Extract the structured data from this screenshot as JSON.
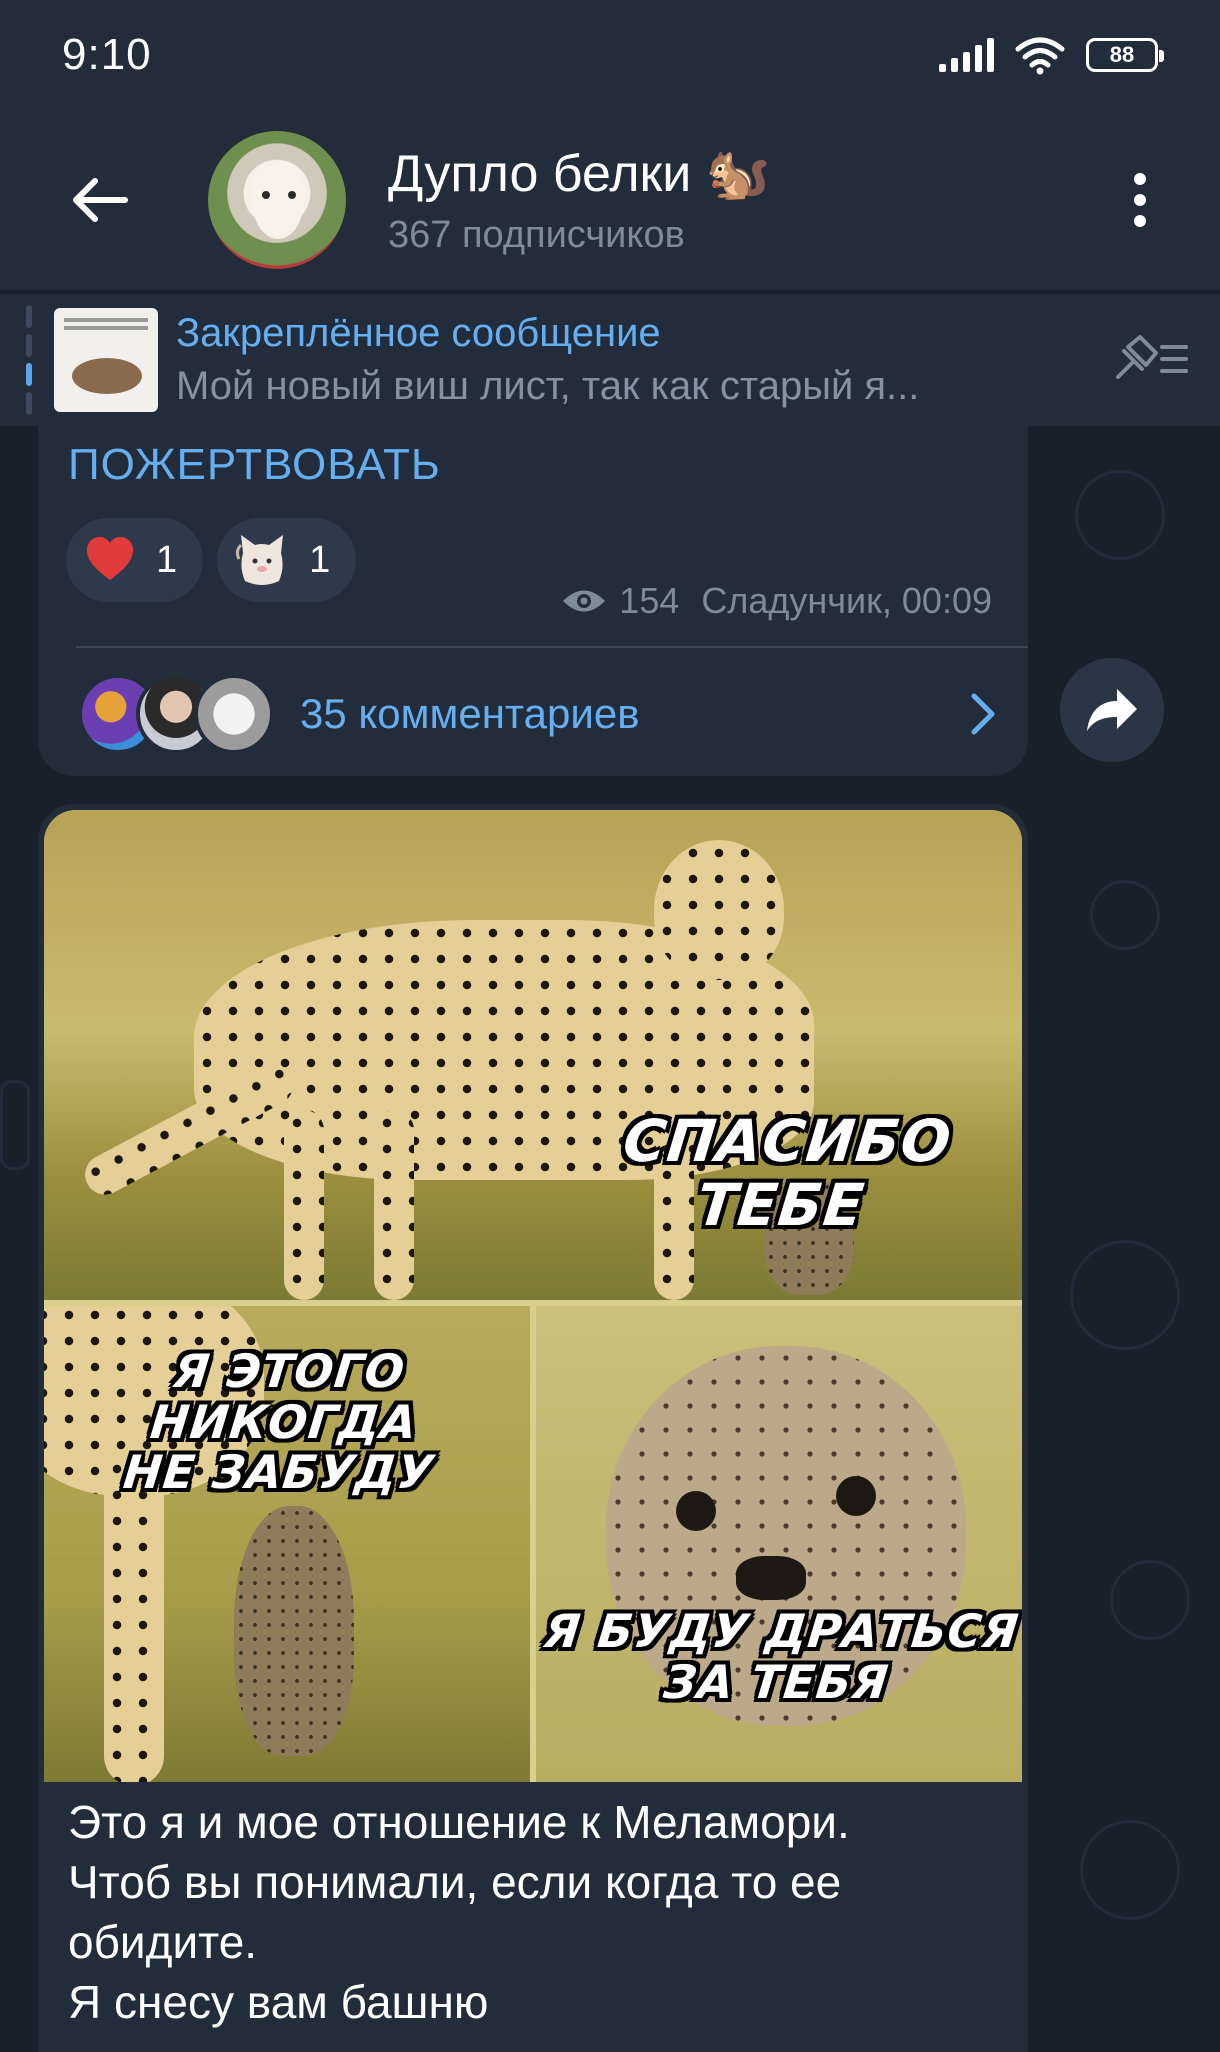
{
  "status_bar": {
    "time": "9:10",
    "battery": "88"
  },
  "header": {
    "channel_title": "Дупло белки 🐿️",
    "subscribers": "367 подписчиков"
  },
  "pinned": {
    "title": "Закреплённое сообщение",
    "text": "Мой новый виш лист, так как старый я..."
  },
  "message1": {
    "donate_link": "ПОЖЕРТВОВАТЬ",
    "reactions": [
      {
        "icon": "heart-icon",
        "count": "1"
      },
      {
        "icon": "cat-sticker-icon",
        "count": "1"
      }
    ],
    "views": "154",
    "author_time": "Сладунчик, 00:09",
    "comments_label": "35 комментариев"
  },
  "message2": {
    "meme_captions": {
      "top": "СПАСИБО ТЕБЕ",
      "bottom_left": "Я ЭТОГО НИКОГДА\nНЕ ЗАБУДУ",
      "bottom_right": "Я БУДУ ДРАТЬСЯ\nЗА ТЕБЯ"
    },
    "text_lines": [
      "Это я и мое отношение к Меламори.",
      "Чтоб вы понимали, если когда то ее",
      "обидите.",
      "Я снесу вам башню"
    ]
  },
  "colors": {
    "accent": "#65aef0",
    "bubble": "#222c3b",
    "background": "#18202c"
  }
}
